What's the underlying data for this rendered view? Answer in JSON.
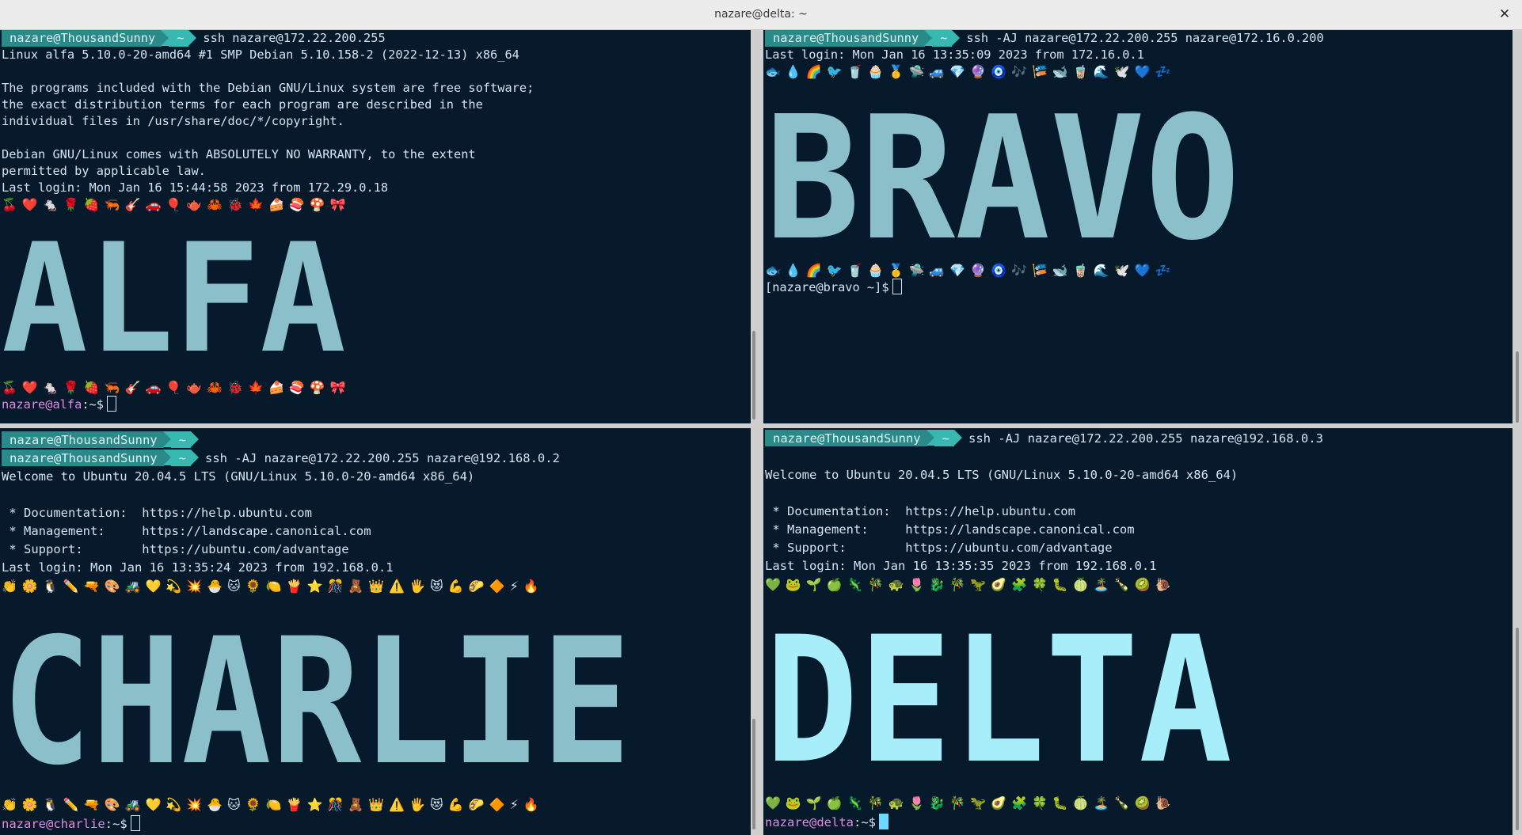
{
  "window": {
    "title": "nazare@delta: ~",
    "close_label": "✕"
  },
  "prompt": {
    "user_host": "nazare@ThousandSunny",
    "dir": "~"
  },
  "panes": {
    "alfa": {
      "command": "ssh nazare@172.22.200.255",
      "output": [
        "Linux alfa 5.10.0-20-amd64 #1 SMP Debian 5.10.158-2 (2022-12-13) x86_64",
        "",
        "The programs included with the Debian GNU/Linux system are free software;",
        "the exact distribution terms for each program are described in the",
        "individual files in /usr/share/doc/*/copyright.",
        "",
        "Debian GNU/Linux comes with ABSOLUTELY NO WARRANTY, to the extent",
        "permitted by applicable law.",
        "Last login: Mon Jan 16 15:44:58 2023 from 172.29.0.18"
      ],
      "emoji_row": "🍒❤️🐁🌹🍓🦐🎸🚗🎈🫖🦀🐞🍁🍰🍣🍄🎀",
      "banner": "ALFA",
      "banner_color": "#8bbfca",
      "shell_prompt_user": "nazare@alfa",
      "shell_prompt_tail": ":~$"
    },
    "bravo": {
      "command": "ssh -AJ nazare@172.22.200.255 nazare@172.16.0.200",
      "output": [
        "Last login: Mon Jan 16 13:35:09 2023 from 172.16.0.1"
      ],
      "emoji_row": "🐟💧🌈🐦🥤🧁🥇🛸🚙💎🔮🧿🎶🎏🐋🧋🌊🕊️💙💤",
      "banner": "BRAVO",
      "banner_color": "#8bbfca",
      "shell_prompt": "[nazare@bravo ~]$"
    },
    "charlie": {
      "command": "ssh -AJ nazare@172.22.200.255 nazare@192.168.0.2",
      "output": [
        "Welcome to Ubuntu 20.04.5 LTS (GNU/Linux 5.10.0-20-amd64 x86_64)",
        "",
        " * Documentation:  https://help.ubuntu.com",
        " * Management:     https://landscape.canonical.com",
        " * Support:        https://ubuntu.com/advantage",
        "Last login: Mon Jan 16 13:35:24 2023 from 192.168.0.1"
      ],
      "emoji_row": "👏🌼🐧✏️🔫🎨🚜💛💫💥🐣🐱🌻🍋🍟⭐🎊🧸👑⚠️🖐️😻💪🌮🔶⚡🔥",
      "banner": "CHARLIE",
      "banner_color": "#8bbfca",
      "shell_prompt_user": "nazare@charlie",
      "shell_prompt_tail": ":~$"
    },
    "delta": {
      "command": "ssh -AJ nazare@172.22.200.255 nazare@192.168.0.3",
      "output": [
        "",
        "Welcome to Ubuntu 20.04.5 LTS (GNU/Linux 5.10.0-20-amd64 x86_64)",
        "",
        " * Documentation:  https://help.ubuntu.com",
        " * Management:     https://landscape.canonical.com",
        " * Support:        https://ubuntu.com/advantage",
        "Last login: Mon Jan 16 13:35:35 2023 from 192.168.0.1"
      ],
      "emoji_row": "💚🐸🌱🍏🦎🎋🐢🌷🐉🎋🦖🥑🧩🍀🐛🍈🏝️🍾🥝🐌",
      "banner": "DELTA",
      "banner_color": "#a8eefa",
      "shell_prompt_user": "nazare@delta",
      "shell_prompt_tail": ":~$"
    }
  }
}
